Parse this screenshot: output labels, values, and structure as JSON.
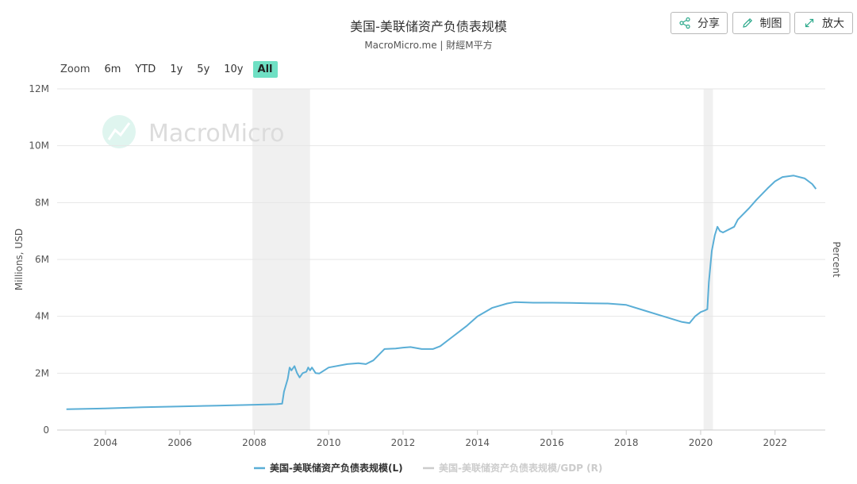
{
  "header": {
    "title": "美国-美联储资产负债表规模",
    "subtitle": "MacroMicro.me | 財經M平方"
  },
  "toolbar": {
    "share_label": "分享",
    "draw_label": "制图",
    "expand_label": "放大"
  },
  "zoom": {
    "label": "Zoom",
    "options": [
      "6m",
      "YTD",
      "1y",
      "5y",
      "10y",
      "All"
    ],
    "selected": "All"
  },
  "watermark": "MacroMicro",
  "colors": {
    "series": "#5aaed6",
    "inactive_series": "#cccccc",
    "recession": "#f0f0f0",
    "zoom_active": "#6fe0c4"
  },
  "chart_data": {
    "type": "line",
    "ylabel": "Millions, USD",
    "ylabel_right": "Percent",
    "ylim": [
      0,
      12000000
    ],
    "xlim": [
      2002.7,
      2023.35
    ],
    "y_ticks": [
      {
        "value": 0,
        "label": "0"
      },
      {
        "value": 2000000,
        "label": "2M"
      },
      {
        "value": 4000000,
        "label": "4M"
      },
      {
        "value": 6000000,
        "label": "6M"
      },
      {
        "value": 8000000,
        "label": "8M"
      },
      {
        "value": 10000000,
        "label": "10M"
      },
      {
        "value": 12000000,
        "label": "12M"
      }
    ],
    "x_ticks": [
      {
        "value": 2004,
        "label": "2004"
      },
      {
        "value": 2006,
        "label": "2006"
      },
      {
        "value": 2008,
        "label": "2008"
      },
      {
        "value": 2010,
        "label": "2010"
      },
      {
        "value": 2012,
        "label": "2012"
      },
      {
        "value": 2014,
        "label": "2014"
      },
      {
        "value": 2016,
        "label": "2016"
      },
      {
        "value": 2018,
        "label": "2018"
      },
      {
        "value": 2020,
        "label": "2020"
      },
      {
        "value": 2022,
        "label": "2022"
      }
    ],
    "recessions": [
      [
        2007.95,
        2009.5
      ],
      [
        2020.08,
        2020.33
      ]
    ],
    "grid": true,
    "legend_position": "bottom",
    "series": [
      {
        "name": "美国-美联储资产负债表规模(L)",
        "active": true,
        "points": [
          [
            2002.95,
            730000
          ],
          [
            2004.0,
            760000
          ],
          [
            2005.0,
            800000
          ],
          [
            2006.0,
            830000
          ],
          [
            2007.0,
            860000
          ],
          [
            2008.0,
            890000
          ],
          [
            2008.6,
            910000
          ],
          [
            2008.75,
            930000
          ],
          [
            2008.8,
            1350000
          ],
          [
            2008.9,
            1800000
          ],
          [
            2008.95,
            2200000
          ],
          [
            2009.0,
            2100000
          ],
          [
            2009.08,
            2250000
          ],
          [
            2009.15,
            2000000
          ],
          [
            2009.22,
            1850000
          ],
          [
            2009.3,
            2000000
          ],
          [
            2009.4,
            2050000
          ],
          [
            2009.45,
            2200000
          ],
          [
            2009.5,
            2100000
          ],
          [
            2009.55,
            2200000
          ],
          [
            2009.65,
            2000000
          ],
          [
            2009.75,
            1990000
          ],
          [
            2010.0,
            2200000
          ],
          [
            2010.5,
            2320000
          ],
          [
            2010.8,
            2350000
          ],
          [
            2011.0,
            2320000
          ],
          [
            2011.2,
            2450000
          ],
          [
            2011.5,
            2850000
          ],
          [
            2011.8,
            2870000
          ],
          [
            2012.0,
            2900000
          ],
          [
            2012.2,
            2920000
          ],
          [
            2012.5,
            2850000
          ],
          [
            2012.8,
            2850000
          ],
          [
            2013.0,
            2950000
          ],
          [
            2013.3,
            3250000
          ],
          [
            2013.7,
            3650000
          ],
          [
            2014.0,
            4000000
          ],
          [
            2014.4,
            4300000
          ],
          [
            2014.8,
            4450000
          ],
          [
            2015.0,
            4500000
          ],
          [
            2015.5,
            4480000
          ],
          [
            2016.0,
            4480000
          ],
          [
            2016.5,
            4470000
          ],
          [
            2017.0,
            4460000
          ],
          [
            2017.5,
            4450000
          ],
          [
            2018.0,
            4400000
          ],
          [
            2018.5,
            4200000
          ],
          [
            2019.0,
            4000000
          ],
          [
            2019.5,
            3800000
          ],
          [
            2019.7,
            3760000
          ],
          [
            2019.85,
            4000000
          ],
          [
            2020.0,
            4150000
          ],
          [
            2020.1,
            4200000
          ],
          [
            2020.18,
            4250000
          ],
          [
            2020.22,
            5200000
          ],
          [
            2020.3,
            6300000
          ],
          [
            2020.38,
            6850000
          ],
          [
            2020.45,
            7150000
          ],
          [
            2020.52,
            7000000
          ],
          [
            2020.6,
            6950000
          ],
          [
            2020.9,
            7150000
          ],
          [
            2021.0,
            7400000
          ],
          [
            2021.3,
            7800000
          ],
          [
            2021.5,
            8100000
          ],
          [
            2021.8,
            8500000
          ],
          [
            2022.0,
            8750000
          ],
          [
            2022.2,
            8900000
          ],
          [
            2022.5,
            8950000
          ],
          [
            2022.8,
            8850000
          ],
          [
            2023.0,
            8650000
          ],
          [
            2023.1,
            8480000
          ]
        ]
      },
      {
        "name": "美国-美联储资产负债表规模/GDP (R)",
        "active": false,
        "points": []
      }
    ]
  }
}
